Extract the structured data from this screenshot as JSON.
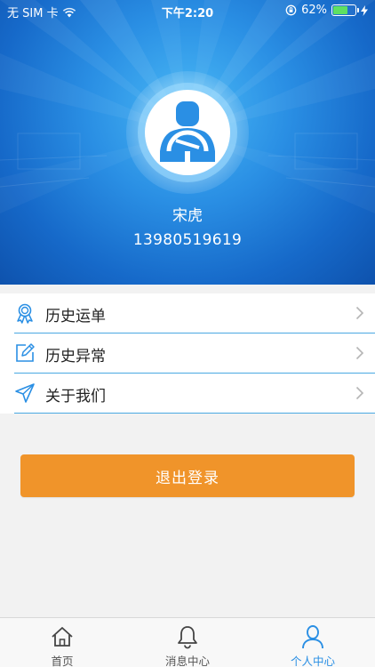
{
  "status_bar": {
    "carrier": "无 SIM 卡",
    "time": "下午2:20",
    "battery_percent": "62%",
    "battery_level": 0.62
  },
  "profile": {
    "name": "宋虎",
    "phone": "13980519619"
  },
  "menu": {
    "items": [
      {
        "label": "历史运单",
        "icon": "ribbon-award-icon"
      },
      {
        "label": "历史异常",
        "icon": "edit-icon"
      },
      {
        "label": "关于我们",
        "icon": "paper-plane-icon"
      }
    ]
  },
  "logout_label": "退出登录",
  "tabbar": {
    "tabs": [
      {
        "label": "首页",
        "icon": "home-icon",
        "active": false
      },
      {
        "label": "消息中心",
        "icon": "bell-icon",
        "active": false
      },
      {
        "label": "个人中心",
        "icon": "person-icon",
        "active": true
      }
    ]
  },
  "colors": {
    "primary_blue": "#2a8fe4",
    "accent_orange": "#f0942a",
    "divider_blue": "#4aa8e2"
  }
}
